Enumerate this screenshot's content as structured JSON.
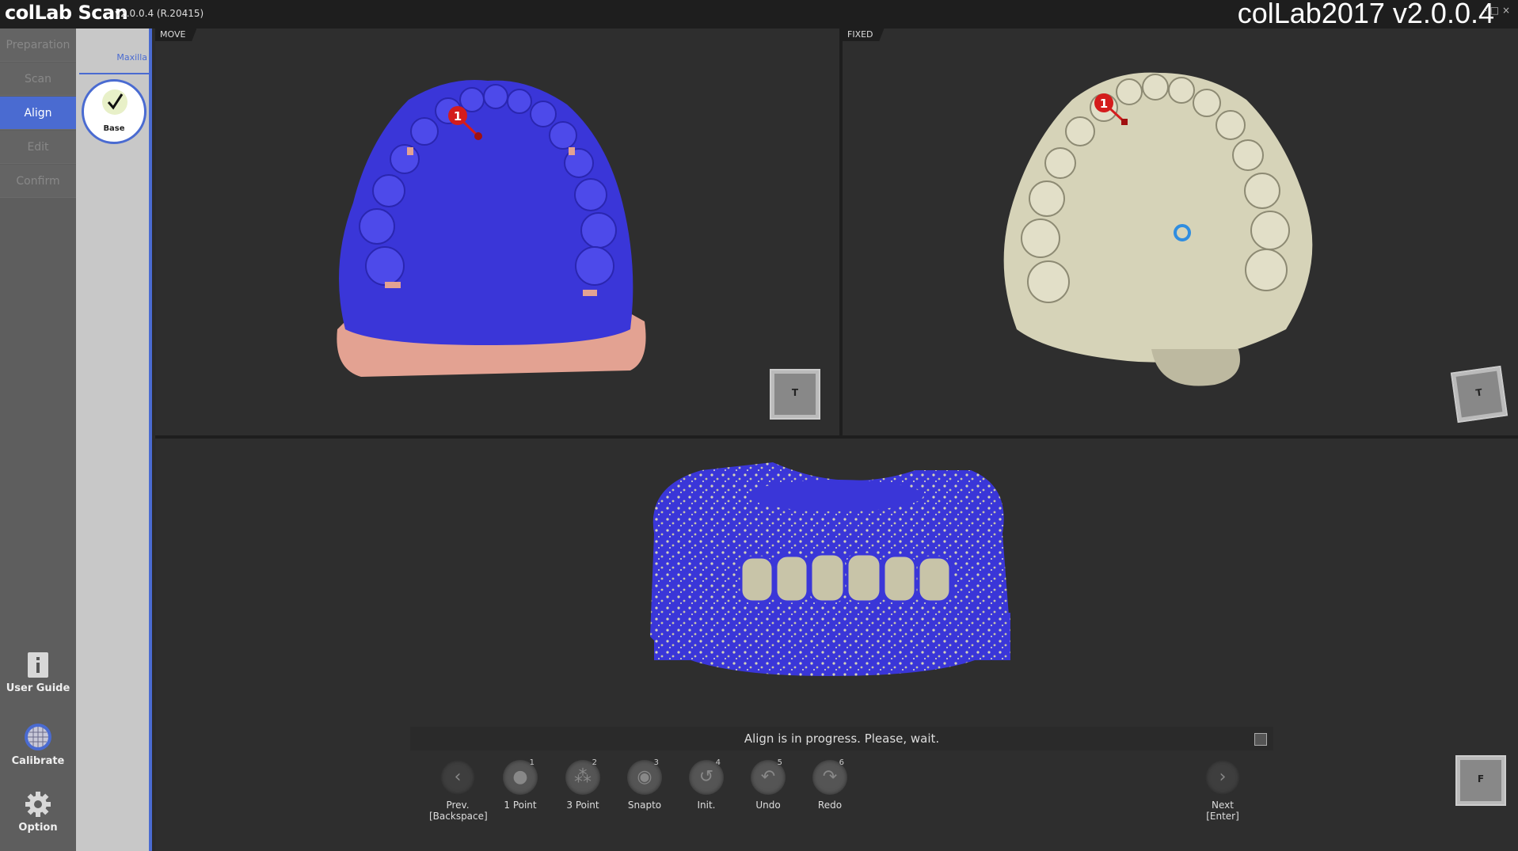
{
  "titlebar": {
    "app_name": "colLab Scan",
    "version": "v2.0.0.4 (R.20415)",
    "big_title": "colLab2017 v2.0.0.4",
    "window_controls": "- □ ×"
  },
  "leftnav": {
    "items": [
      {
        "label": "Preparation",
        "state": "disabled"
      },
      {
        "label": "Scan",
        "state": "disabled"
      },
      {
        "label": "Align",
        "state": "active"
      },
      {
        "label": "Edit",
        "state": "disabled"
      },
      {
        "label": "Confirm",
        "state": "disabled"
      }
    ],
    "bottom_tools": [
      {
        "label": "User Guide",
        "icon": "info-icon"
      },
      {
        "label": "Calibrate",
        "icon": "calibrate-grid-icon"
      },
      {
        "label": "Option",
        "icon": "gear-icon"
      }
    ]
  },
  "subpanel": {
    "tab_label": "Maxilla",
    "card_label": "Base"
  },
  "viewports": {
    "move": {
      "tag": "MOVE",
      "cube_label": "T",
      "marker": "1"
    },
    "fixed": {
      "tag": "FIXED",
      "cube_label": "T",
      "marker": "1"
    },
    "bottom": {
      "cube_label": "F"
    }
  },
  "status": {
    "message": "Align is in progress. Please, wait."
  },
  "toolbar": {
    "prev": {
      "label": "Prev.",
      "shortcut": "[Backspace]"
    },
    "next": {
      "label": "Next",
      "shortcut": "[Enter]"
    },
    "tools": [
      {
        "num": "1",
        "label": "1 Point"
      },
      {
        "num": "2",
        "label": "3 Point"
      },
      {
        "num": "3",
        "label": "Snapto"
      },
      {
        "num": "4",
        "label": "Init."
      },
      {
        "num": "5",
        "label": "Undo"
      },
      {
        "num": "6",
        "label": "Redo"
      }
    ]
  },
  "colors": {
    "accent": "#4a6bd1",
    "mesh_blue": "#3b3bd9",
    "mesh_pink": "#e8a090",
    "mesh_stone": "#d6d3b8",
    "marker_red": "#d41c1c"
  }
}
